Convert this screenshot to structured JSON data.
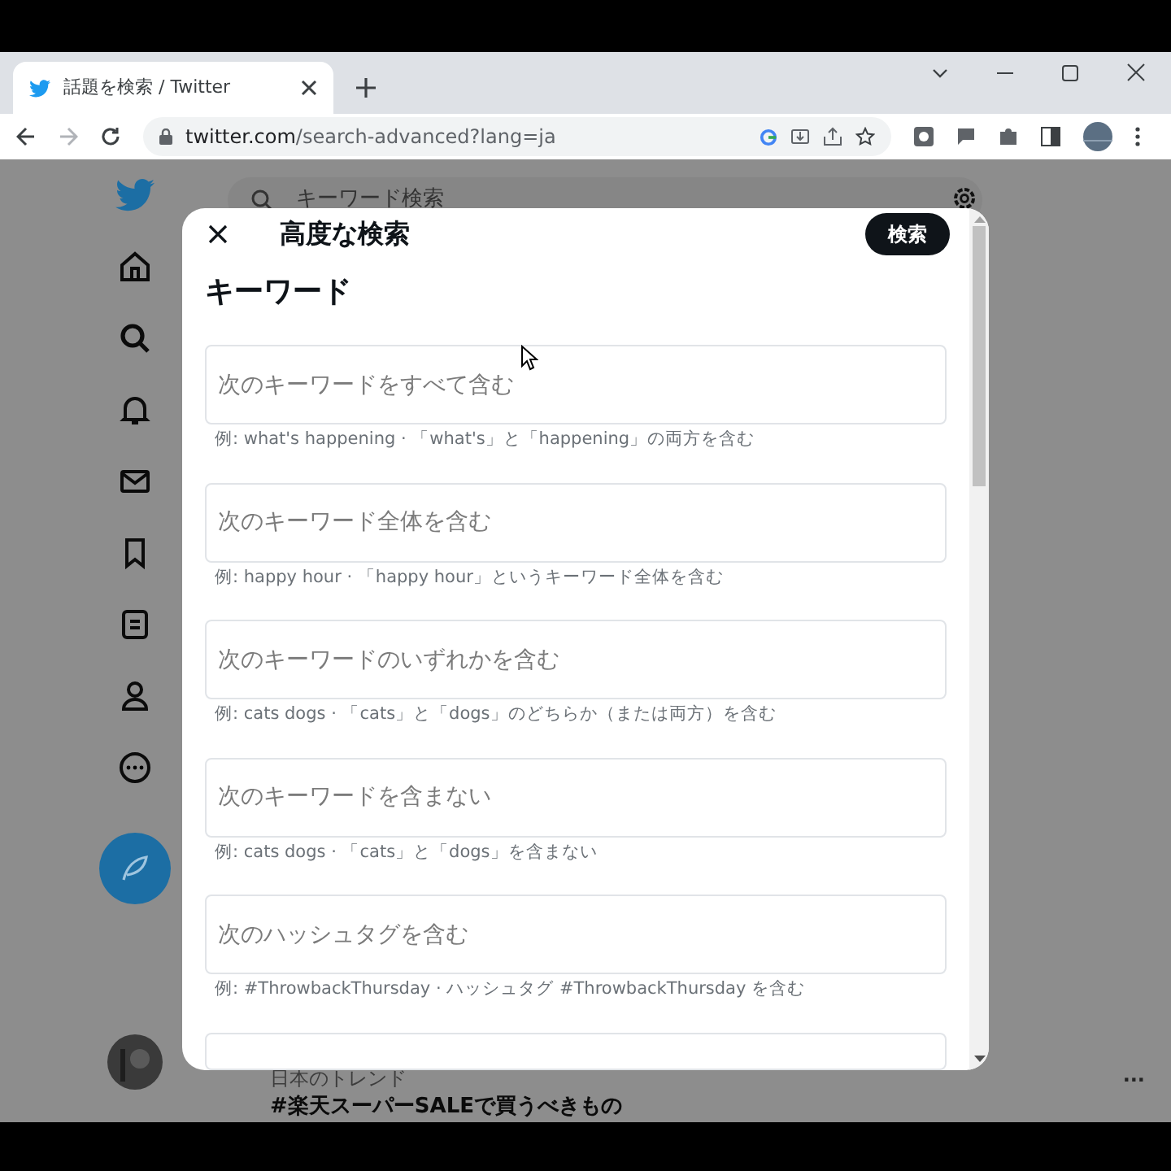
{
  "browser": {
    "tab_title": "話題を検索 / Twitter",
    "url_host": "twitter.com",
    "url_path": "/search-advanced?lang=ja"
  },
  "page": {
    "search_placeholder": "キーワード検索",
    "trend_label": "日本のトレンド",
    "trend_title": "#楽天スーパーSALEで買うべきもの",
    "trend_more": "···"
  },
  "dialog": {
    "title": "高度な検索",
    "search_button": "検索",
    "section": "キーワード",
    "fields": [
      {
        "placeholder": "次のキーワードをすべて含む",
        "hint": "例: what's happening · 「what's」と「happening」の両方を含む"
      },
      {
        "placeholder": "次のキーワード全体を含む",
        "hint": "例: happy hour · 「happy hour」というキーワード全体を含む"
      },
      {
        "placeholder": "次のキーワードのいずれかを含む",
        "hint": "例: cats dogs · 「cats」と「dogs」のどちらか（または両方）を含む"
      },
      {
        "placeholder": "次のキーワードを含まない",
        "hint": "例: cats dogs · 「cats」と「dogs」を含まない"
      },
      {
        "placeholder": "次のハッシュタグを含む",
        "hint": "例: #ThrowbackThursday · ハッシュタグ #ThrowbackThursday を含む"
      }
    ]
  }
}
